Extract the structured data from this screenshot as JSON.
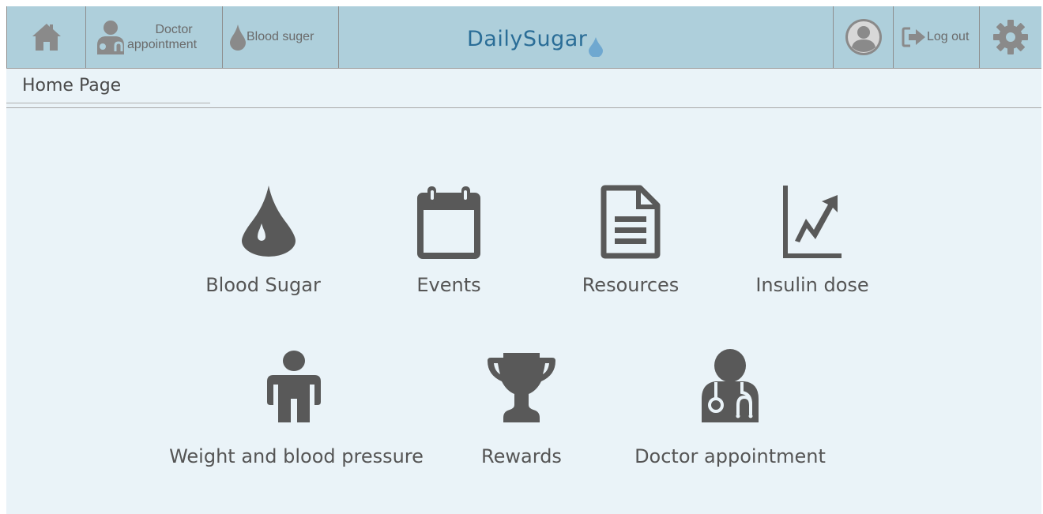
{
  "topbar": {
    "home_icon": "home-icon",
    "doctor_label_line1": "Doctor",
    "doctor_label_line2": "appointment",
    "blood_sugar_label": "Blood suger",
    "logo": "DailySugar",
    "profile_icon": "user-circle-icon",
    "logout_label": "Log out",
    "settings_icon": "gear-icon"
  },
  "page": {
    "title": "Home Page"
  },
  "tiles": [
    {
      "label": "Blood Sugar",
      "icon": "drop-icon"
    },
    {
      "label": "Events",
      "icon": "calendar-icon"
    },
    {
      "label": "Resources",
      "icon": "document-icon"
    },
    {
      "label": "Insulin dose",
      "icon": "chart-icon"
    },
    {
      "label": "Weight and blood pressure",
      "icon": "person-icon"
    },
    {
      "label": "Rewards",
      "icon": "trophy-icon"
    },
    {
      "label": "Doctor appointment",
      "icon": "doctor-icon"
    }
  ],
  "colors": {
    "topbar_bg": "#aecfdb",
    "page_bg": "#eaf3f8",
    "icon": "#595959",
    "logo": "#2a6d97",
    "logo_drop": "#6fa8d0"
  }
}
